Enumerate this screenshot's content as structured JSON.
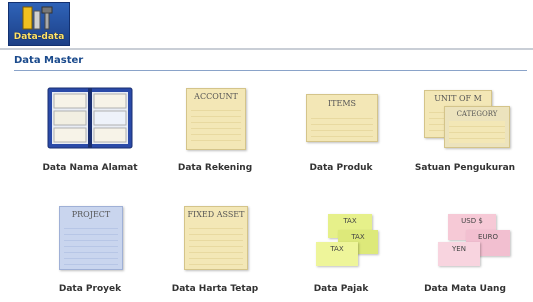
{
  "app": {
    "logo_caption": "Data-data"
  },
  "section": {
    "title": "Data Master"
  },
  "tiles": [
    {
      "label": "Data Nama Alamat"
    },
    {
      "label": "Data Rekening",
      "icon_text": "Account"
    },
    {
      "label": "Data Produk",
      "icon_text": "Items"
    },
    {
      "label": "Satuan Pengukuran",
      "icon_text_1": "Unit of M",
      "icon_text_2": "Category"
    },
    {
      "label": "Data Proyek",
      "icon_text": "Project"
    },
    {
      "label": "Data Harta Tetap",
      "icon_text": "Fixed Asset"
    },
    {
      "label": "Data Pajak",
      "notes": [
        "TAX",
        "TAX",
        "TAX"
      ]
    },
    {
      "label": "Data Mata Uang",
      "notes": [
        "USD $",
        "EURO",
        "YEN"
      ]
    }
  ],
  "colors": {
    "accent": "#1a4a8c",
    "paper": "#f3e7b6",
    "paper_blue": "#c9d5ee",
    "note_green": "#e6f08a",
    "note_pink": "#f6c9d6"
  }
}
